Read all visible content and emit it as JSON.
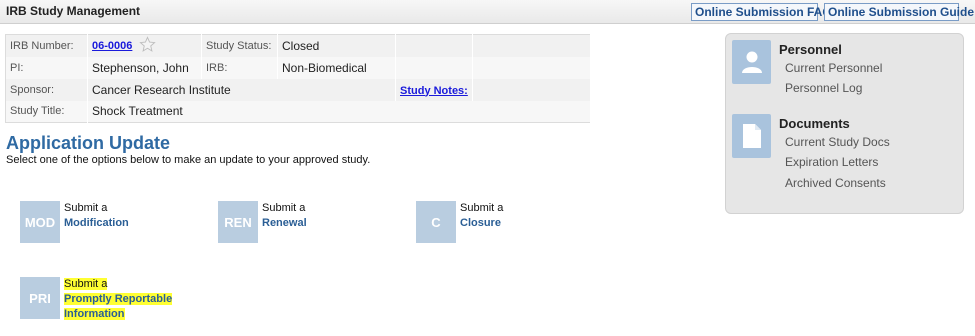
{
  "header": {
    "title": "IRB Study Management",
    "faq_label": "Online Submission FAQ",
    "guide_label": "Online Submission Guide"
  },
  "study": {
    "irb_number_label": "IRB Number:",
    "irb_number": "06-0006",
    "status_label": "Study Status:",
    "status": "Closed",
    "pi_label": "PI:",
    "pi": "Stephenson, John",
    "irb_label": "IRB:",
    "irb": "Non-Biomedical",
    "sponsor_label": "Sponsor:",
    "sponsor": "Cancer Research Institute",
    "notes_label": "Study Notes:",
    "title_label": "Study Title:",
    "title": "Shock Treatment"
  },
  "main": {
    "heading": "Application Update",
    "subheading": "Select one of the options below to make an update to your approved study.",
    "options": [
      {
        "icon": "MOD",
        "pre": "Submit a",
        "name": "Modification"
      },
      {
        "icon": "REN",
        "pre": "Submit a",
        "name": "Renewal"
      },
      {
        "icon": "C",
        "pre": "Submit a",
        "name": "Closure"
      },
      {
        "icon": "PRI",
        "pre": "Submit a",
        "name_line1": "Promptly Reportable",
        "name_line2": "Information"
      }
    ]
  },
  "sidebar": {
    "personnel": {
      "icon": "person-icon",
      "title": "Personnel",
      "links": [
        "Current Personnel",
        "Personnel Log"
      ]
    },
    "documents": {
      "icon": "document-icon",
      "title": "Documents",
      "links": [
        "Current Study Docs",
        "Expiration Letters",
        "Archived Consents"
      ]
    }
  },
  "colors": {
    "accent": "#2f6aa3",
    "highlight": "#ffff33",
    "icon_tile": "#b9cde0"
  }
}
